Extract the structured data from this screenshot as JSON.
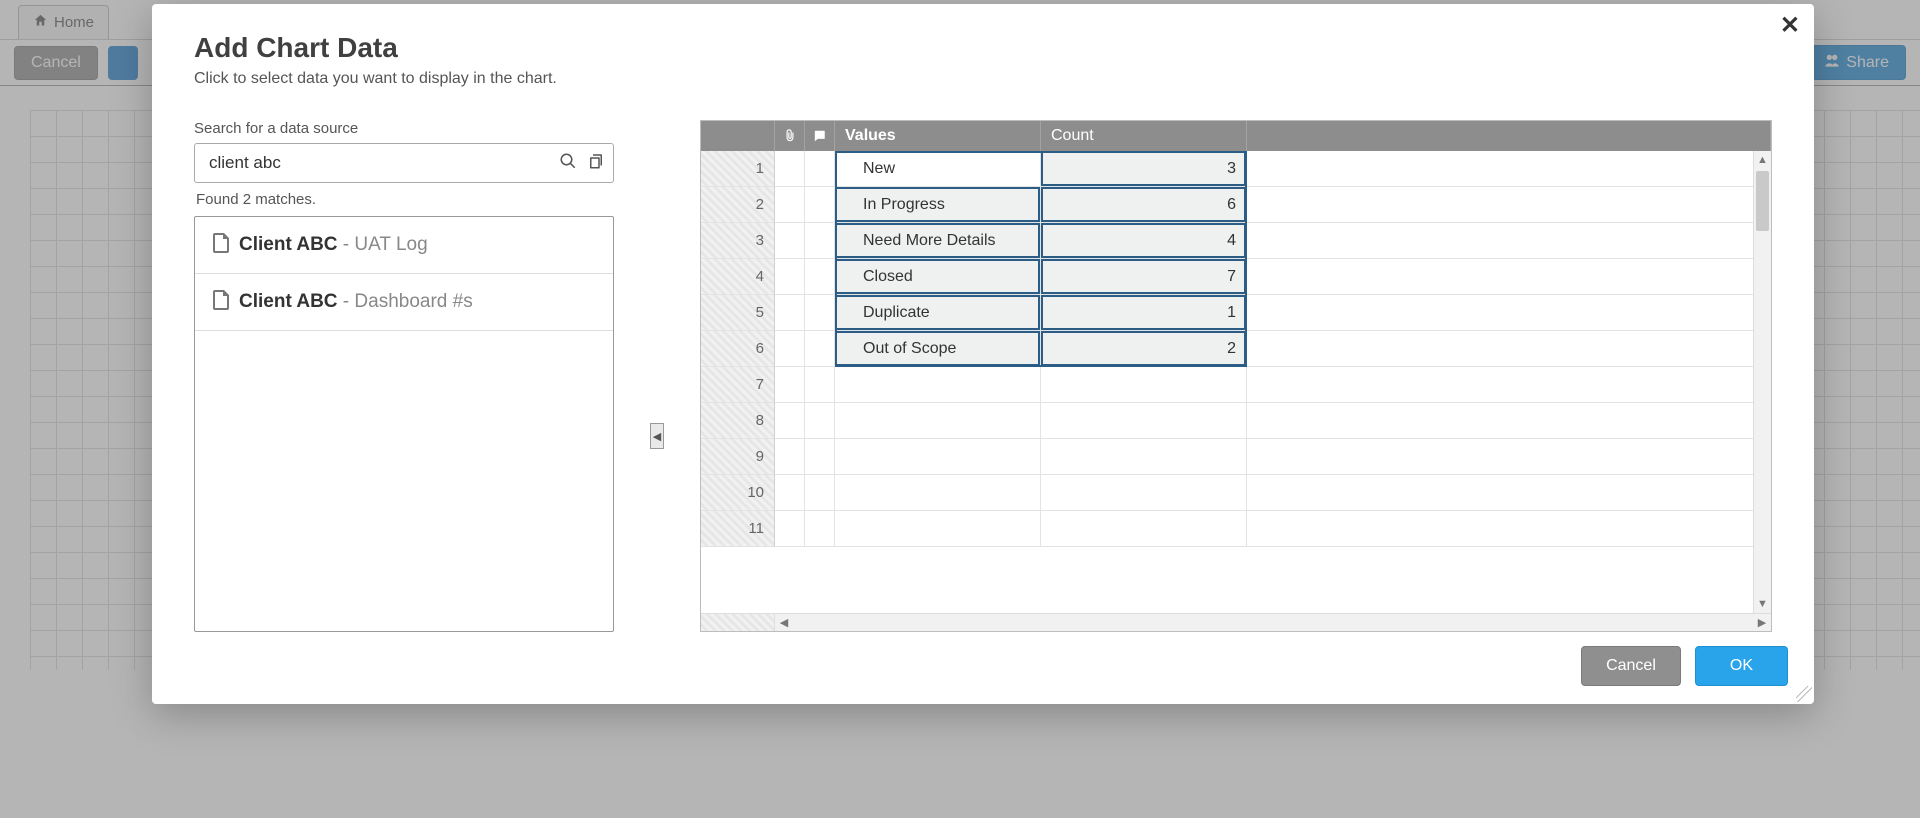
{
  "background": {
    "home_tab": "Home",
    "cancel_button": "Cancel",
    "share_button": "Share"
  },
  "modal": {
    "title": "Add Chart Data",
    "subtitle": "Click to select data you want to display in the chart.",
    "search_label": "Search for a data source",
    "search_value": "client abc",
    "matches_text": "Found 2 matches.",
    "results": [
      {
        "bold": "Client ABC",
        "suffix": "UAT Log"
      },
      {
        "bold": "Client ABC",
        "suffix": "Dashboard #s"
      }
    ],
    "columns": {
      "values": "Values",
      "count": "Count"
    },
    "rows": [
      {
        "value": "New",
        "count": "3"
      },
      {
        "value": "In Progress",
        "count": "6"
      },
      {
        "value": "Need More Details",
        "count": "4"
      },
      {
        "value": "Closed",
        "count": "7"
      },
      {
        "value": "Duplicate",
        "count": "1"
      },
      {
        "value": "Out of Scope",
        "count": "2"
      }
    ],
    "row_numbers": [
      "1",
      "2",
      "3",
      "4",
      "5",
      "6",
      "7",
      "8",
      "9",
      "10",
      "11"
    ],
    "footer": {
      "cancel": "Cancel",
      "ok": "OK"
    }
  },
  "chart_data": {
    "type": "table",
    "title": "Add Chart Data",
    "columns": [
      "Values",
      "Count"
    ],
    "rows": [
      [
        "New",
        3
      ],
      [
        "In Progress",
        6
      ],
      [
        "Need More Details",
        4
      ],
      [
        "Closed",
        7
      ],
      [
        "Duplicate",
        1
      ],
      [
        "Out of Scope",
        2
      ]
    ]
  }
}
